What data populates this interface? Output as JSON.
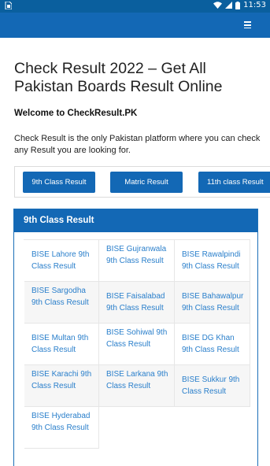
{
  "status_bar": {
    "time": "11:53"
  },
  "app_bar": {
    "menu_icon": "hamburger-menu-icon"
  },
  "page": {
    "title": "Check Result 2022 – Get All Pakistan Boards Result Online",
    "welcome": "Welcome to CheckResult.PK",
    "intro": "Check Result is the only Pakistan platform where you can check any Result you are looking for."
  },
  "tabs": [
    {
      "label": "9th Class Result"
    },
    {
      "label": "Matric Result"
    },
    {
      "label": "11th class Result"
    }
  ],
  "card": {
    "title": "9th Class Result",
    "links": [
      "BISE Lahore 9th Class Result",
      "BISE Gujranwala 9th Class Result",
      "BISE Rawalpindi 9th Class Result",
      "BISE Sargodha 9th Class Result",
      "BISE Faisalabad 9th Class Result",
      "BISE Bahawalpur 9th Class Result",
      "BISE Multan 9th Class Result",
      "BISE Sohiwal 9th Class Result",
      "BISE DG Khan 9th Class Result",
      "BISE Karachi 9th Class Result",
      "BISE Larkana 9th Class Result",
      "BISE Sukkur 9th Class Result",
      "BISE Hyderabad 9th Class Result"
    ]
  },
  "colors": {
    "primary": "#1368b5",
    "status_bar": "#0a5f9e",
    "link": "#2a7fcb"
  }
}
